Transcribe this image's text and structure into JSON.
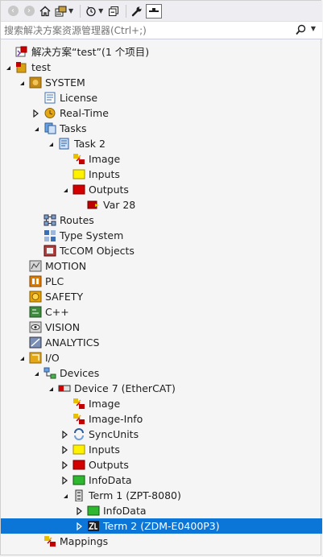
{
  "toolbar": {
    "buttons": [
      {
        "name": "back-icon",
        "glyph": "‹"
      },
      {
        "name": "forward-icon",
        "glyph": "›"
      },
      {
        "name": "home-icon",
        "glyph": ""
      },
      {
        "name": "sync-with-active-icon",
        "glyph": ""
      },
      {
        "name": "pending-changes-icon",
        "glyph": ""
      },
      {
        "name": "collapse-all-icon",
        "glyph": ""
      },
      {
        "name": "properties-wrench-icon",
        "glyph": ""
      },
      {
        "name": "preview-toggle-icon",
        "glyph": ""
      }
    ]
  },
  "search": {
    "placeholder": "搜索解决方案资源管理器(Ctrl+;)"
  },
  "tree": [
    {
      "label": "解决方案“test”(1 个项目)",
      "level": 0,
      "arrow": "none",
      "icon": "solution-icon"
    },
    {
      "label": "test",
      "level": 0,
      "arrow": "expanded",
      "icon": "project-icon"
    },
    {
      "label": "SYSTEM",
      "level": 1,
      "arrow": "expanded",
      "icon": "system-icon"
    },
    {
      "label": "License",
      "level": 2,
      "arrow": "none",
      "icon": "license-icon"
    },
    {
      "label": "Real-Time",
      "level": 2,
      "arrow": "collapsed",
      "icon": "realtime-icon"
    },
    {
      "label": "Tasks",
      "level": 2,
      "arrow": "expanded",
      "icon": "tasks-icon"
    },
    {
      "label": "Task 2",
      "level": 3,
      "arrow": "expanded",
      "icon": "task-icon"
    },
    {
      "label": "Image",
      "level": 4,
      "arrow": "none",
      "icon": "image-icon"
    },
    {
      "label": "Inputs",
      "level": 4,
      "arrow": "none",
      "icon": "inputs-icon"
    },
    {
      "label": "Outputs",
      "level": 4,
      "arrow": "expanded",
      "icon": "outputs-icon"
    },
    {
      "label": "Var 28",
      "level": 5,
      "arrow": "none",
      "icon": "variable-icon"
    },
    {
      "label": "Routes",
      "level": 2,
      "arrow": "none",
      "icon": "routes-icon"
    },
    {
      "label": "Type System",
      "level": 2,
      "arrow": "none",
      "icon": "type-system-icon"
    },
    {
      "label": "TcCOM Objects",
      "level": 2,
      "arrow": "none",
      "icon": "tccom-icon"
    },
    {
      "label": "MOTION",
      "level": 1,
      "arrow": "none",
      "icon": "motion-icon"
    },
    {
      "label": "PLC",
      "level": 1,
      "arrow": "none",
      "icon": "plc-icon"
    },
    {
      "label": "SAFETY",
      "level": 1,
      "arrow": "none",
      "icon": "safety-icon"
    },
    {
      "label": "C++",
      "level": 1,
      "arrow": "none",
      "icon": "cpp-icon"
    },
    {
      "label": "VISION",
      "level": 1,
      "arrow": "none",
      "icon": "vision-icon"
    },
    {
      "label": "ANALYTICS",
      "level": 1,
      "arrow": "none",
      "icon": "analytics-icon"
    },
    {
      "label": "I/O",
      "level": 1,
      "arrow": "expanded",
      "icon": "io-icon"
    },
    {
      "label": "Devices",
      "level": 2,
      "arrow": "expanded",
      "icon": "devices-icon"
    },
    {
      "label": "Device 7 (EtherCAT)",
      "level": 3,
      "arrow": "expanded",
      "icon": "ethercat-device-icon"
    },
    {
      "label": "Image",
      "level": 4,
      "arrow": "none",
      "icon": "image-icon"
    },
    {
      "label": "Image-Info",
      "level": 4,
      "arrow": "none",
      "icon": "image-icon"
    },
    {
      "label": "SyncUnits",
      "level": 4,
      "arrow": "collapsed",
      "icon": "syncunits-icon"
    },
    {
      "label": "Inputs",
      "level": 4,
      "arrow": "collapsed",
      "icon": "inputs-icon"
    },
    {
      "label": "Outputs",
      "level": 4,
      "arrow": "collapsed",
      "icon": "outputs-icon"
    },
    {
      "label": "InfoData",
      "level": 4,
      "arrow": "collapsed",
      "icon": "infodata-icon"
    },
    {
      "label": "Term 1 (ZPT-8080)",
      "level": 4,
      "arrow": "expanded",
      "icon": "terminal-icon"
    },
    {
      "label": "InfoData",
      "level": 5,
      "arrow": "collapsed",
      "icon": "infodata-icon"
    },
    {
      "label": "Term 2 (ZDM-E0400P3)",
      "level": 5,
      "arrow": "collapsed",
      "icon": "motor-terminal-icon",
      "selected": true
    },
    {
      "label": "Mappings",
      "level": 2,
      "arrow": "none",
      "icon": "mappings-icon"
    }
  ],
  "colors": {
    "selection": "#0b75d8",
    "background": "#f5f5f5",
    "toolbar": "#eeeef2"
  }
}
